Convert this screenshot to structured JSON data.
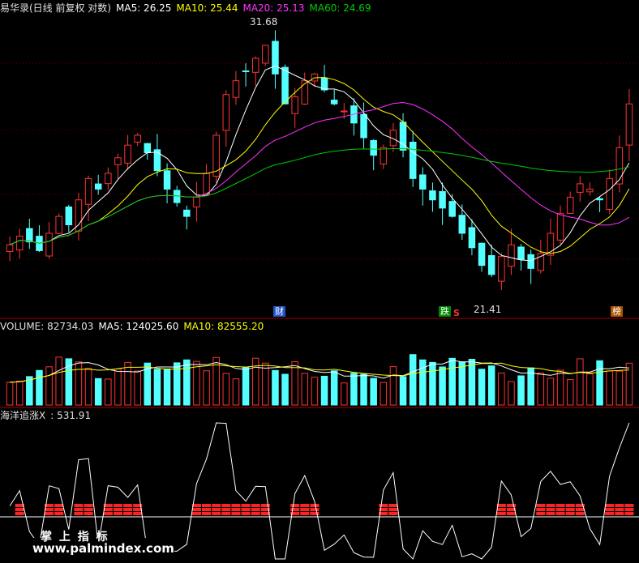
{
  "header_price": {
    "title": "易华录(日线 前复权 对数)",
    "ma5": "MA5: 26.25",
    "ma10": "MA10: 25.44",
    "ma20": "MA20: 25.13",
    "ma60": "MA60: 24.69"
  },
  "header_volume": {
    "volume": "VOLUME: 82734.03",
    "ma5": "MA5: 124025.60",
    "ma10": "MA10: 82555.20"
  },
  "header_indicator": {
    "name": "海洋追涨X",
    "value": ": 531.91"
  },
  "annotations": {
    "high": "31.68",
    "low": "21.41",
    "tag_cai": "财",
    "tag_die": "跌",
    "tag_s": "S",
    "tag_bang": "榜"
  },
  "watermark": {
    "line1": "掌 上 指 标",
    "line2": "www.palmindex.com"
  },
  "colors": {
    "up": "#ff3333",
    "down": "#54ffff",
    "ma5": "#ffffff",
    "ma10": "#ffff00",
    "ma20": "#ff33ff",
    "ma60": "#00cc00",
    "grid": "#aa0000",
    "signal": "#ff2222"
  },
  "chart_data": [
    {
      "type": "candlestick",
      "title": "易华录(日线 前复权 对数)",
      "series": [
        {
          "name": "MA5",
          "value": 26.25
        },
        {
          "name": "MA10",
          "value": 25.44
        },
        {
          "name": "MA20",
          "value": 25.13
        },
        {
          "name": "MA60",
          "value": 24.69
        }
      ],
      "ylim": [
        21.0,
        32.5
      ],
      "log_scale": true,
      "high": 31.68,
      "low": 21.41,
      "close": [
        23.2,
        23.5,
        23.3,
        23.0,
        23.6,
        24.2,
        23.9,
        24.8,
        25.6,
        25.2,
        25.8,
        26.4,
        26.9,
        27.3,
        26.6,
        25.9,
        25.2,
        24.7,
        24.2,
        24.9,
        25.8,
        27.3,
        29.0,
        29.6,
        30.0,
        30.6,
        31.2,
        29.9,
        28.6,
        28.9,
        29.6,
        29.9,
        29.2,
        28.6,
        28.3,
        27.8,
        27.2,
        26.5,
        26.8,
        27.5,
        26.7,
        25.6,
        25.2,
        24.8,
        24.5,
        24.2,
        23.6,
        23.1,
        22.5,
        22.2,
        22.8,
        23.2,
        22.7,
        22.4,
        22.9,
        23.6,
        24.3,
        24.9,
        25.4,
        25.2,
        24.8,
        25.6,
        26.8,
        28.6
      ],
      "volume_series": [
        {
          "name": "VOLUME",
          "value": 82734.03
        },
        {
          "name": "MA5",
          "value": 124025.6
        },
        {
          "name": "MA10",
          "value": 82555.2
        }
      ],
      "indicator": {
        "name": "海洋追涨X",
        "value": 531.91
      }
    }
  ]
}
